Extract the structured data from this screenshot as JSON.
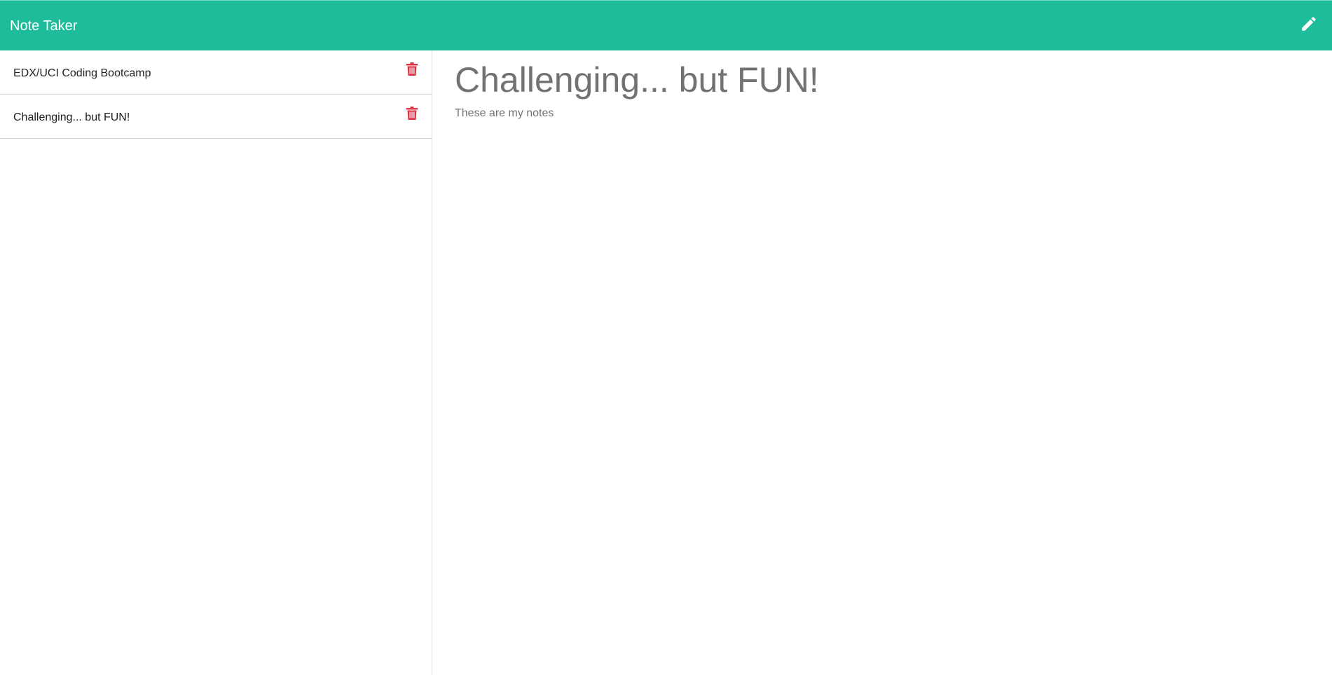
{
  "app": {
    "title": "Note Taker",
    "accent_color": "#1dbd9c",
    "new_note_icon": "pencil-icon"
  },
  "sidebar": {
    "delete_icon": "trash-icon",
    "delete_color": "#dc3545",
    "notes": [
      {
        "title": "EDX/UCI Coding Bootcamp"
      },
      {
        "title": "Challenging... but FUN!"
      }
    ]
  },
  "active_note": {
    "title": "Challenging... but FUN!",
    "text": "These are my notes"
  }
}
